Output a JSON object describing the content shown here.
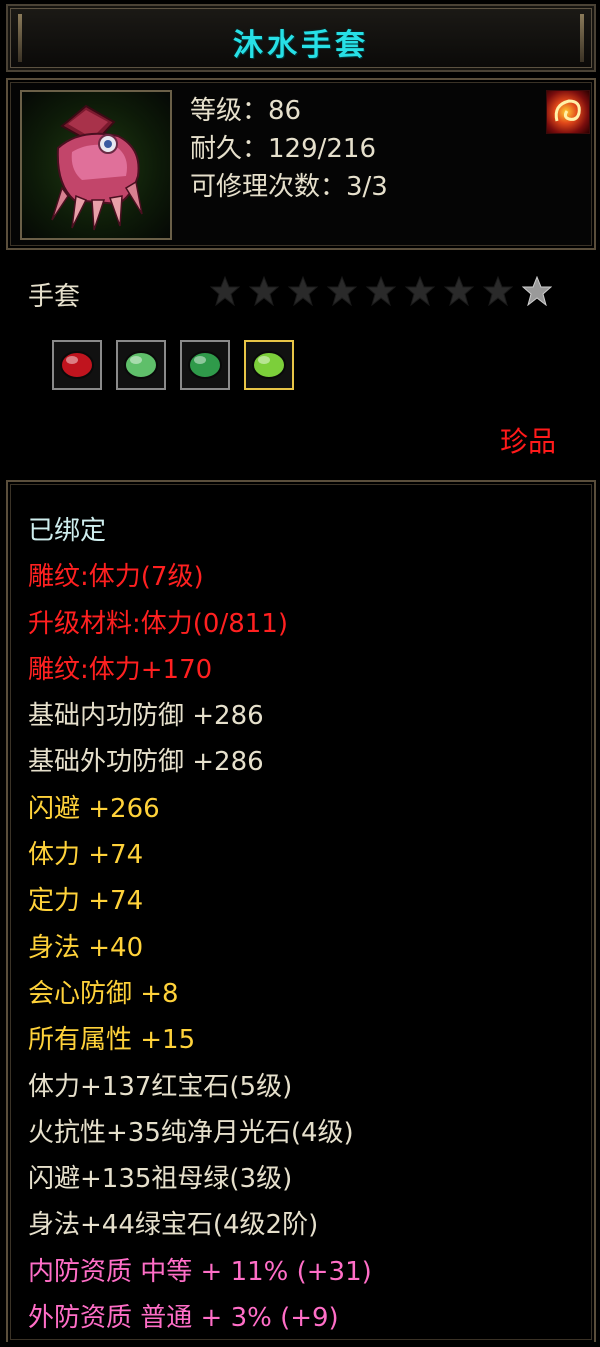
{
  "item": {
    "name": "沐水手套",
    "level": "等级：86",
    "durability": "耐久：129/216",
    "repairs": "可修理次数：3/3",
    "slot": "手套",
    "rarity": "珍品",
    "icon": "red-gauntlet-icon",
    "element_icon": "fire-swirl-icon"
  },
  "stars": {
    "total": 9,
    "filled": 1
  },
  "gems": [
    {
      "icon": "red-ruby-gem-icon",
      "color": "#c0141e",
      "selected": false
    },
    {
      "icon": "green-crescent-gem-icon",
      "color": "#5fbf6a",
      "selected": false
    },
    {
      "icon": "green-jade-ring-gem-icon",
      "color": "#2f9a4a",
      "selected": false
    },
    {
      "icon": "green-emerald-gem-icon",
      "color": "#7ccf3a",
      "selected": true
    }
  ],
  "attributes": [
    {
      "text": "已绑定",
      "tone": "cyan"
    },
    {
      "text": "雕纹:体力(7级)",
      "tone": "red"
    },
    {
      "text": "升级材料:体力(0/811)",
      "tone": "red"
    },
    {
      "text": "雕纹:体力+170",
      "tone": "red"
    },
    {
      "text": "基础内功防御 +286",
      "tone": "white"
    },
    {
      "text": "基础外功防御 +286",
      "tone": "white"
    },
    {
      "text": "闪避 +266",
      "tone": "gold"
    },
    {
      "text": "体力 +74",
      "tone": "gold"
    },
    {
      "text": "定力 +74",
      "tone": "gold"
    },
    {
      "text": "身法 +40",
      "tone": "gold"
    },
    {
      "text": "会心防御 +8",
      "tone": "gold"
    },
    {
      "text": "所有属性 +15",
      "tone": "gold"
    },
    {
      "text": "体力+137红宝石(5级)",
      "tone": "white"
    },
    {
      "text": "火抗性+35纯净月光石(4级)",
      "tone": "white"
    },
    {
      "text": "闪避+135祖母绿(3级)",
      "tone": "white"
    },
    {
      "text": "身法+44绿宝石(4级2阶)",
      "tone": "white"
    },
    {
      "text": "内防资质 中等 + 11% (+31)",
      "tone": "pink"
    },
    {
      "text": "外防资质 普通 + 3% (+9)",
      "tone": "pink"
    }
  ]
}
